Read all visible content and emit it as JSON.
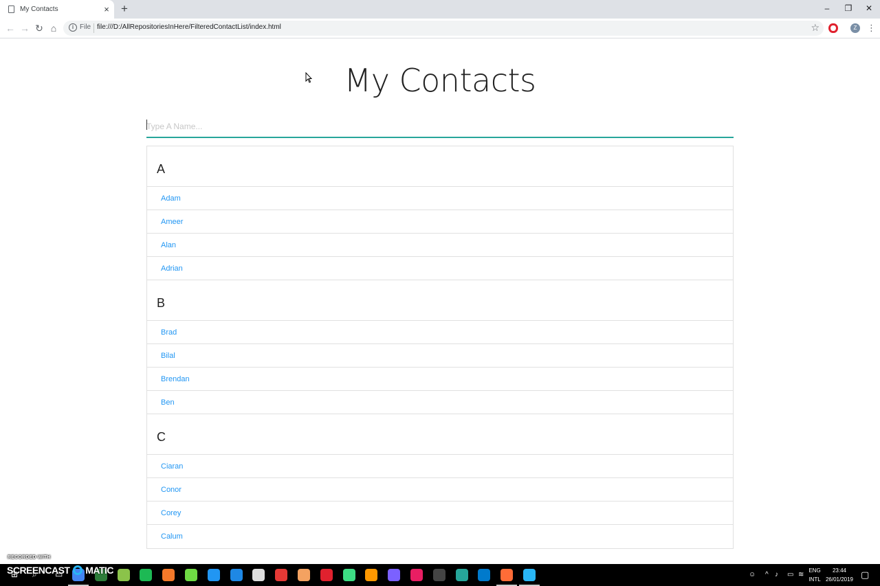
{
  "browser": {
    "tab_title": "My Contacts",
    "tab_close": "×",
    "new_tab": "+",
    "scheme_label": "File",
    "url": "file:///D:/AllRepositoriesInHere/FilteredContactList/index.html",
    "profile_initial": "Z",
    "window_controls": {
      "minimize": "–",
      "restore": "❐",
      "close": "✕"
    }
  },
  "page": {
    "title": "My Contacts",
    "search": {
      "placeholder": "Type A Name...",
      "value": ""
    },
    "groups": [
      {
        "letter": "A",
        "names": [
          "Adam",
          "Ameer",
          "Alan",
          "Adrian"
        ]
      },
      {
        "letter": "B",
        "names": [
          "Brad",
          "Bilal",
          "Brendan",
          "Ben"
        ]
      },
      {
        "letter": "C",
        "names": [
          "Ciaran",
          "Conor",
          "Corey",
          "Calum"
        ]
      }
    ]
  },
  "watermark": {
    "recorded_with": "RECORDED WITH",
    "brand_left": "SCREENCAST",
    "brand_right": "MATIC"
  },
  "taskbar": {
    "language": "ENG",
    "layout": "INTL",
    "time": "23:44",
    "date": "26/01/2019",
    "apps": [
      {
        "name": "chrome-icon",
        "color": "#4285f4"
      },
      {
        "name": "store-icon",
        "color": "#2d7d3a"
      },
      {
        "name": "notepad-icon",
        "color": "#8bc34a"
      },
      {
        "name": "spotify-icon",
        "color": "#1db954"
      },
      {
        "name": "blender-icon",
        "color": "#f5792a"
      },
      {
        "name": "upwork-icon",
        "color": "#6fda44"
      },
      {
        "name": "flag-app-icon",
        "color": "#2196f3"
      },
      {
        "name": "maps-icon",
        "color": "#1e88e5"
      },
      {
        "name": "unity-icon",
        "color": "#dddddd"
      },
      {
        "name": "acrobat-icon",
        "color": "#e53935"
      },
      {
        "name": "orb-icon",
        "color": "#f4a261"
      },
      {
        "name": "opera-icon",
        "color": "#e0212e"
      },
      {
        "name": "android-studio-icon",
        "color": "#3ddc84"
      },
      {
        "name": "sublime-icon",
        "color": "#ff9800"
      },
      {
        "name": "obs-icon",
        "color": "#7b61ff"
      },
      {
        "name": "intellij-icon",
        "color": "#e91e63"
      },
      {
        "name": "terminal-icon",
        "color": "#444444"
      },
      {
        "name": "gitkraken-icon",
        "color": "#26a69a"
      },
      {
        "name": "vscode-icon",
        "color": "#007acc"
      },
      {
        "name": "postman-icon",
        "color": "#ff6c37"
      },
      {
        "name": "screencast-icon",
        "color": "#29b6f6"
      }
    ]
  }
}
